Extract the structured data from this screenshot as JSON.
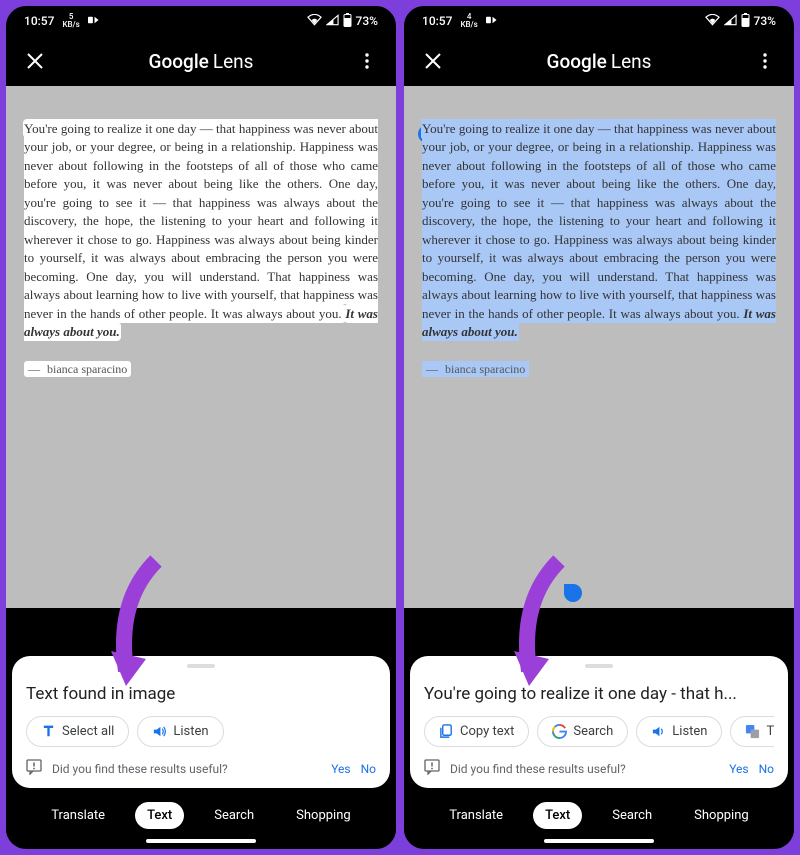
{
  "status": {
    "time_left": "10:57",
    "kbs_left": "5",
    "kbs_unit": "KB/s",
    "time_right": "10:57",
    "kbs_right": "4",
    "battery": "73%"
  },
  "header": {
    "title_brand": "Google",
    "title_product": "Lens"
  },
  "quote": {
    "text": "You're going to realize it one day — that happiness was never about your job, or your degree, or being in a relationship. Happiness was never about following in the footsteps of all of those who came before you, it was never about being like the others. One day, you're going to see it — that happiness was always about the discovery, the hope, the listening to your heart and following it wherever it chose to go. Happiness was always about being kinder to yourself, it was always about embracing the person you were becoming. One day, you will understand. That happiness was always about learning how to live with yourself, that happiness was never in the hands of other people. It was always about you. ",
    "emphasis": "It was always about you.",
    "author_prefix": "— ",
    "author": "bianca sparacino"
  },
  "sheet_left": {
    "title": "Text found in image",
    "chips": {
      "select_all": "Select all",
      "listen": "Listen"
    }
  },
  "sheet_right": {
    "title": "You're going to realize it one day - that h...",
    "chips": {
      "copy": "Copy text",
      "search": "Search",
      "listen": "Listen",
      "translate": "Tra"
    }
  },
  "feedback": {
    "question": "Did you find these results useful?",
    "yes": "Yes",
    "no": "No"
  },
  "tabs": {
    "translate": "Translate",
    "text": "Text",
    "search": "Search",
    "shopping": "Shopping"
  }
}
